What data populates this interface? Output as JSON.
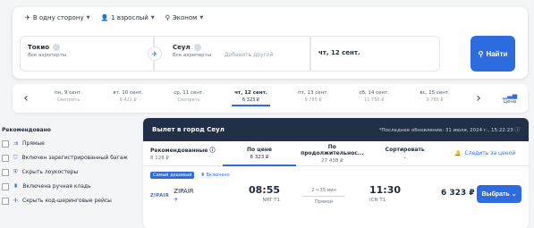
{
  "search": {
    "options": {
      "trip_type": "В одну сторону",
      "passengers": "1 взрослый",
      "class": "Эконом"
    },
    "from": {
      "city": "Токио",
      "sub": "Все аэропорты"
    },
    "to": {
      "city": "Сеул",
      "sub": "Все аэропорты"
    },
    "add_other_placeholder": "Добавить другой",
    "date": "чт, 12 сент.",
    "find_label": "Найти"
  },
  "dates": [
    {
      "day": "пн, 9 сент.",
      "price": "Смотреть"
    },
    {
      "day": "вт, 10 сент.",
      "price": "8 421 ₽"
    },
    {
      "day": "ср, 11 сент.",
      "price": "Смотреть"
    },
    {
      "day": "чт, 12 сент.",
      "price": "6 323 ₽"
    },
    {
      "day": "пт, 13 сент.",
      "price": "9 785 ₽"
    },
    {
      "day": "сб, 14 сент.",
      "price": "11 756 ₽"
    },
    {
      "day": "вс, 15 сент.",
      "price": "9 785 ₽"
    }
  ],
  "price_link_label": "Цена",
  "sidebar": {
    "title": "Рекомендовано",
    "filters": [
      "Прямые",
      "Включен зарегистрированный багаж",
      "Скрыть лоукостеры",
      "Включена ручная кладь",
      "Скрыть код-шеринговые рейсы"
    ]
  },
  "results": {
    "header_title": "Вылет в город Сеул",
    "updated": "*Последнее обновление: 31 июля, 2024 г., 15:22:23",
    "sorts": [
      {
        "label": "Рекомендованные",
        "value": "8 128 ₽"
      },
      {
        "label": "По цене",
        "value": "6 323 ₽"
      },
      {
        "label": "По продолжительнос...",
        "value": "27 438 ₽"
      },
      {
        "label": "Сортировать",
        "value": ""
      }
    ],
    "track_label": "Следить за ценой",
    "flight": {
      "badge_cheap": "Самый дешевый",
      "badge_bag": "Включено",
      "airline_logo": "ZIPAIR",
      "airline": "ZIPAIR",
      "dep_time": "08:55",
      "dep_airport": "NRT T1",
      "duration": "2 ч 35 мин",
      "direct": "Прямой",
      "arr_time": "11:30",
      "arr_airport": "ICN T1",
      "price": "6 323 ₽",
      "choose_label": "Выбрать"
    }
  },
  "colors": {
    "accent": "#2d6cdf",
    "header": "#213046"
  }
}
